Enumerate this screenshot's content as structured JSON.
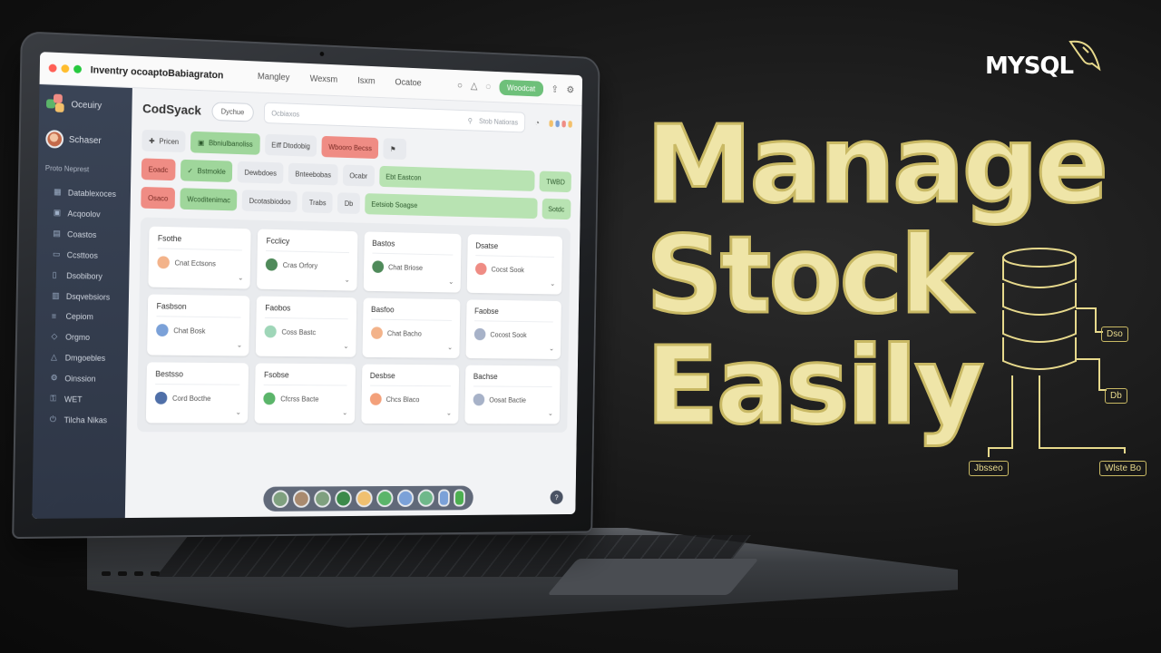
{
  "app": {
    "window_title": "Inventry ocoaptoBabiagraton",
    "nav_links": [
      "Mangley",
      "Wexsm",
      "Isxm",
      "Ocatoe"
    ],
    "header_button": "Woodcat",
    "brand_name": "Oceuiry",
    "user_name": "Schaser",
    "sidebar_section": "Proto Neprest",
    "sidebar_items": [
      {
        "label": "Datablexoces",
        "icon": "grid-icon"
      },
      {
        "label": "Acqoolov",
        "icon": "box-icon"
      },
      {
        "label": "Coastos",
        "icon": "chart-icon"
      },
      {
        "label": "Ccsttoos",
        "icon": "folder-icon"
      },
      {
        "label": "Dsobibory",
        "icon": "file-icon"
      },
      {
        "label": "Dsqvebsiors",
        "icon": "doc-icon"
      },
      {
        "label": "Cepiom",
        "icon": "list-icon"
      },
      {
        "label": "Orgmo",
        "icon": "tag-icon"
      },
      {
        "label": "Dmgoebles",
        "icon": "bell-icon"
      },
      {
        "label": "Oinssion",
        "icon": "settings-icon"
      },
      {
        "label": "WET",
        "icon": "key-icon"
      },
      {
        "label": "Tilcha Nikas",
        "icon": "power-icon"
      }
    ],
    "logo_text": "CodSyack",
    "pill_label": "Dychue",
    "search_placeholder": "Ocbiaxos",
    "search_right_text": "Stob Natioras",
    "chip_rows": [
      [
        {
          "label": "Pricen",
          "style": "plain",
          "icon": "pin-icon"
        },
        {
          "label": "Bbniulbanoliss",
          "style": "green",
          "icon": "card-icon"
        },
        {
          "label": "Eiff Dtodobig",
          "style": "plain",
          "icon": "none"
        },
        {
          "label": "Wbooro Becss",
          "style": "red",
          "icon": "none"
        },
        {
          "label": "",
          "style": "plain",
          "icon": "flag-icon"
        }
      ],
      [
        {
          "label": "Eoadc",
          "style": "red",
          "icon": "none"
        },
        {
          "label": "Bstmokle",
          "style": "green",
          "icon": "check-icon"
        },
        {
          "label": "Dewbdoes",
          "style": "plain",
          "icon": "none"
        },
        {
          "label": "Bnteebobas",
          "style": "plain",
          "icon": "none"
        },
        {
          "label": "Ocabr",
          "style": "plain",
          "icon": "none"
        },
        {
          "label": "Ebt  Eastcon",
          "style": "light-green",
          "icon": "none"
        },
        {
          "label": "TWBD",
          "style": "light-green",
          "icon": "none"
        }
      ],
      [
        {
          "label": "Osaco",
          "style": "red",
          "icon": "none"
        },
        {
          "label": "Wcoditenimac",
          "style": "green",
          "icon": "none"
        },
        {
          "label": "Dcotasbiodoo",
          "style": "plain",
          "icon": "none"
        },
        {
          "label": "Trabs",
          "style": "plain",
          "icon": "none"
        },
        {
          "label": "Db",
          "style": "plain",
          "icon": "none"
        },
        {
          "label": "Eetsiob Soagse",
          "style": "light-green",
          "icon": "none"
        },
        {
          "label": "Sotdc",
          "style": "light-green",
          "icon": "none"
        }
      ]
    ],
    "cards": [
      {
        "title": "Fsothe",
        "text": "Cnat Ectsons",
        "color": "#f3b38a"
      },
      {
        "title": "Fcclicy",
        "text": "Cras Orfory",
        "color": "#4f8a5a"
      },
      {
        "title": "Bastos",
        "text": "Chat Briose",
        "color": "#4f8a5a"
      },
      {
        "title": "Dsatse",
        "text": "Cocst Sook",
        "color": "#ef8c84"
      },
      {
        "title": "Fasbson",
        "text": "Chat Bosk",
        "color": "#7ba1d8"
      },
      {
        "title": "Faobos",
        "text": "Coss Bastc",
        "color": "#9fd6b8"
      },
      {
        "title": "Basfoo",
        "text": "Chat Bacho",
        "color": "#f3b38a"
      },
      {
        "title": "Faobse",
        "text": "Cocost Sook",
        "color": "#a7b2c8"
      },
      {
        "title": "Bestsso",
        "text": "Cord Bocthe",
        "color": "#4f6fa8"
      },
      {
        "title": "Fsobse",
        "text": "Cfcrss Bacte",
        "color": "#5bb56a"
      },
      {
        "title": "Desbse",
        "text": "Chcs Blaco",
        "color": "#f3a07a"
      },
      {
        "title": "Bachse",
        "text": "Oosat Bactie",
        "color": "#a7b2c8"
      }
    ],
    "dock_colors": [
      "#7fa07f",
      "#a98a6f",
      "#7fa07f",
      "#3c8a4a",
      "#f0c070",
      "#5bb56a",
      "#7ba1d8",
      "#6fb88a",
      "#7ba1d8",
      "#4caf50"
    ]
  },
  "colors": {
    "accent_green": "#6ec07a",
    "accent_red": "#ef8c84",
    "sidebar": "#3a4456",
    "headline": "#efe5a8"
  },
  "hero": {
    "badge": "MYSQL",
    "headline": [
      "Manage",
      "Stock",
      "Easily"
    ],
    "diagram_labels": [
      "Dso",
      "Db",
      "Jbsseo",
      "Wlste Bo"
    ]
  }
}
